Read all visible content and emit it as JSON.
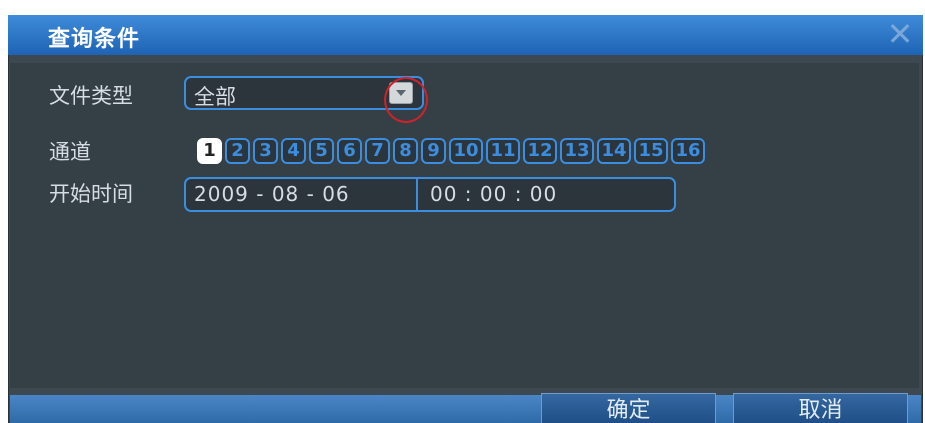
{
  "dialog": {
    "title": "查询条件",
    "close_icon": "close-icon"
  },
  "fields": {
    "file_type_label": "文件类型",
    "file_type_value": "全部",
    "channel_label": "通道",
    "start_time_label": "开始时间",
    "date": "2009 - 08 - 06",
    "time": "00 : 00 : 00"
  },
  "channels": [
    "1",
    "2",
    "3",
    "4",
    "5",
    "6",
    "7",
    "8",
    "9",
    "10",
    "11",
    "12",
    "13",
    "14",
    "15",
    "16"
  ],
  "selected_channel": "1",
  "buttons": {
    "ok": "确定",
    "cancel": "取消"
  },
  "colors": {
    "accent": "#3b8de0",
    "title_bar": "#2e78c8",
    "body_bg": "#3d4850",
    "highlight": "#d0222a"
  }
}
